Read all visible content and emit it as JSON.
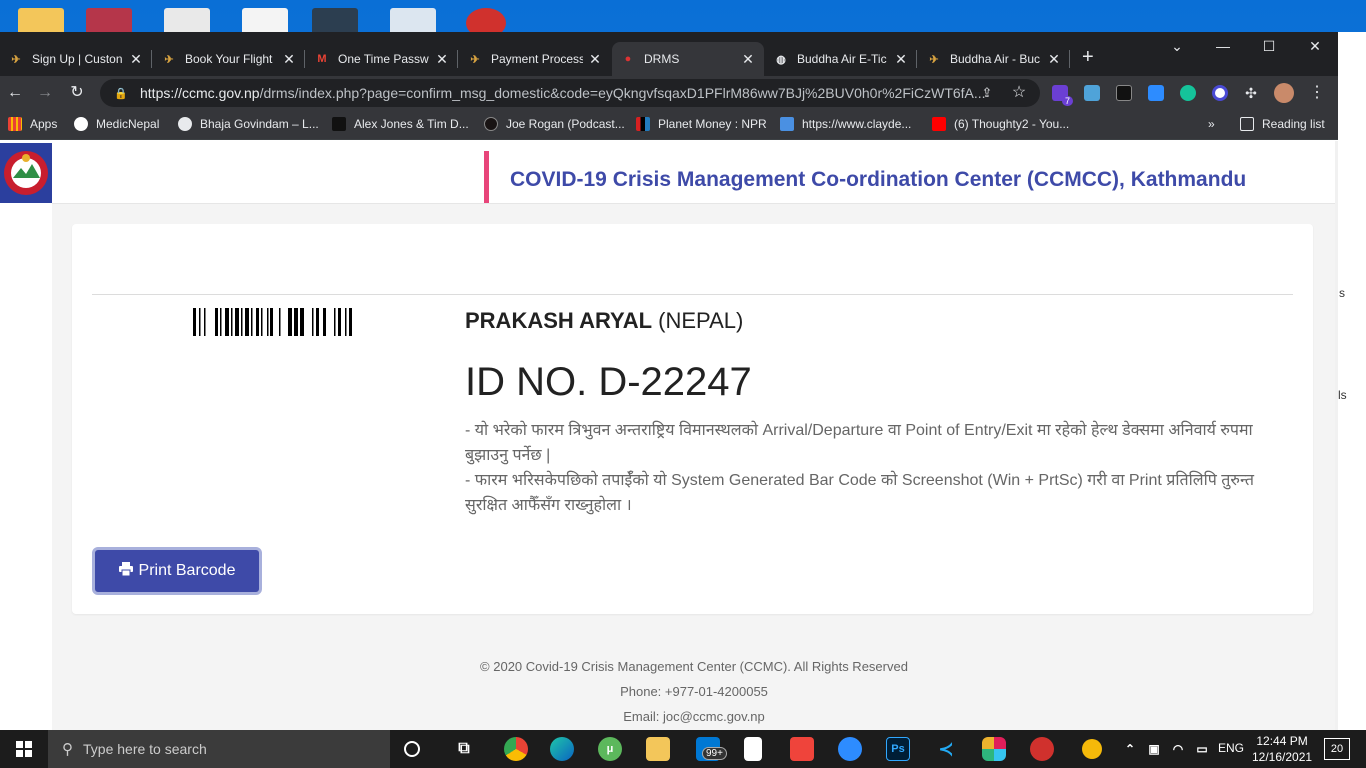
{
  "browser": {
    "tabs": [
      {
        "title": "Sign Up | Custon",
        "icon": "buddha-air-icon"
      },
      {
        "title": "Book Your Flight",
        "icon": "buddha-air-icon"
      },
      {
        "title": "One Time Passw",
        "icon": "gmail-icon"
      },
      {
        "title": "Payment Process",
        "icon": "buddha-air-icon"
      },
      {
        "title": "DRMS",
        "icon": "nepal-emblem-icon"
      },
      {
        "title": "Buddha Air E-Tic",
        "icon": "globe-icon"
      },
      {
        "title": "Buddha Air - Buc",
        "icon": "buddha-air-icon"
      }
    ],
    "url_host": "https://ccmc.gov.np",
    "url_rest": "/drms/index.php?page=confirm_msg_domestic&code=eyQkngvfsqaxD1PFlrM86ww7BJj%2BUV0h0r%2FiCzWT6fA...",
    "extension_badge": "7",
    "bookmarks": [
      {
        "label": "Apps",
        "icon": "apps-grid-icon"
      },
      {
        "label": "MedicNepal",
        "icon": "medic-icon"
      },
      {
        "label": "Bhaja Govindam – L...",
        "icon": "wordpress-icon"
      },
      {
        "label": "Alex Jones & Tim D...",
        "icon": "podcast-icon"
      },
      {
        "label": "Joe Rogan (Podcast...",
        "icon": "spotify-icon"
      },
      {
        "label": "Planet Money : NPR",
        "icon": "npr-icon"
      },
      {
        "label": "https://www.clayde...",
        "icon": "page-icon"
      },
      {
        "label": "(6) Thoughty2 - You...",
        "icon": "youtube-icon"
      }
    ],
    "reading_list": "Reading list"
  },
  "page": {
    "header_title": "COVID-19 Crisis Management Co-ordination Center (CCMCC), Kathmandu",
    "person_name": "PRAKASH ARYAL",
    "country": "(NEPAL)",
    "id_number": "ID NO. D-22247",
    "notes": [
      "- यो भरेको फारम त्रिभुवन अन्तराष्ट्रिय विमानस्थलको Arrival/Departure वा Point of Entry/Exit मा रहेको हेल्थ डेक्समा अनिवार्य रुपमा बुझाउनु पर्नेछ |",
      "- फारम भरिसकेपछिको तपाईँको यो System Generated Bar Code को Screenshot (Win + PrtSc) गरी वा Print प्रतिलिपि तुरुन्त सुरक्षित आफैँसँग राख्नुहोला ।"
    ],
    "print_button": "Print Barcode",
    "footer": {
      "copyright": "© 2020 Covid-19 Crisis Management Center (CCMC). All Rights Reserved",
      "phone": "Phone: +977-01-4200055",
      "email": "Email: joc@ccmc.gov.np"
    }
  },
  "right_edge": {
    "text_1": "s",
    "text_2": "ls"
  },
  "taskbar": {
    "search_placeholder": "Type here to search",
    "mail_badge": "99+",
    "language": "ENG",
    "time": "12:44 PM",
    "date": "12/16/2021",
    "notification_count": "20"
  },
  "colors": {
    "accent": "#3e4aa8",
    "header_bar": "#e8457a"
  }
}
